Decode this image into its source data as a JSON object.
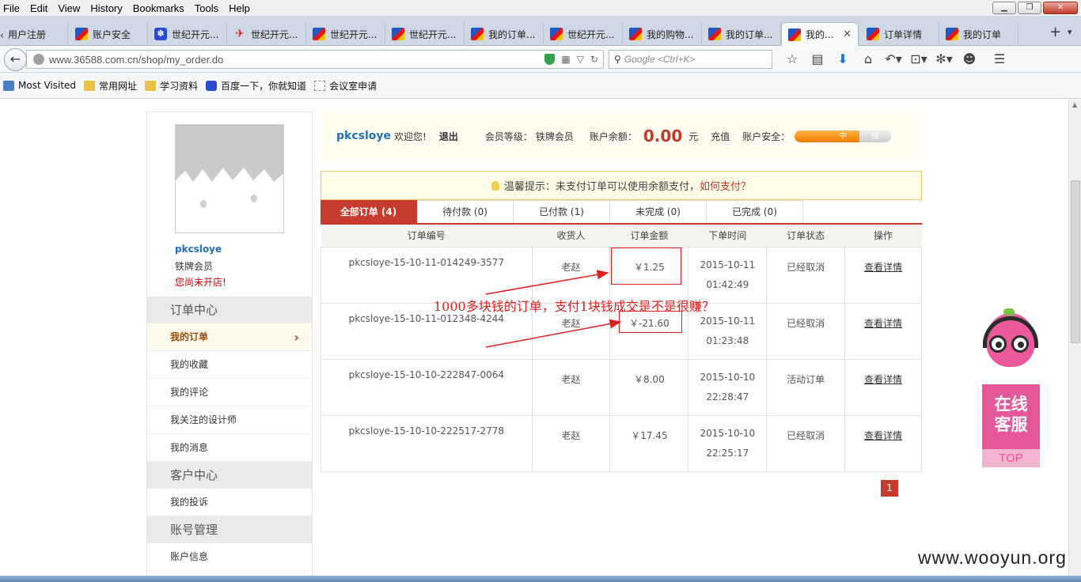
{
  "browser": {
    "menu": [
      "File",
      "Edit",
      "View",
      "History",
      "Bookmarks",
      "Tools",
      "Help"
    ],
    "tabs": [
      {
        "label": "用户注册",
        "icon": "none"
      },
      {
        "label": "账户安全",
        "icon": "brand"
      },
      {
        "label": "世纪开元...",
        "icon": "paw"
      },
      {
        "label": "世纪开元...",
        "icon": "bird"
      },
      {
        "label": "世纪开元...",
        "icon": "brand"
      },
      {
        "label": "世纪开元...",
        "icon": "brand"
      },
      {
        "label": "我的订单...",
        "icon": "brand"
      },
      {
        "label": "世纪开元...",
        "icon": "brand"
      },
      {
        "label": "我的购物...",
        "icon": "brand"
      },
      {
        "label": "我的订单...",
        "icon": "brand"
      },
      {
        "label": "我的...",
        "icon": "brand",
        "active": true
      },
      {
        "label": "订单详情",
        "icon": "brand"
      },
      {
        "label": "我的订单",
        "icon": "brand"
      }
    ],
    "url": "www.36588.com.cn/shop/my_order.do",
    "search_placeholder": "Google <Ctrl+K>",
    "bookmarks": [
      "Most Visited",
      "常用网址",
      "学习资料",
      "百度一下，你就知道",
      "会议室申请"
    ]
  },
  "sidebar": {
    "username": "pkcsloye",
    "level": "铁牌会员",
    "shop_status": "您尚未开店!",
    "sections": [
      {
        "title": "订单中心",
        "items": [
          {
            "label": "我的订单",
            "active": true
          },
          {
            "label": "我的收藏"
          },
          {
            "label": "我的评论"
          },
          {
            "label": "我关注的设计师"
          },
          {
            "label": "我的消息"
          }
        ]
      },
      {
        "title": "客户中心",
        "items": [
          {
            "label": "我的投诉"
          }
        ]
      },
      {
        "title": "账号管理",
        "items": [
          {
            "label": "账户信息"
          }
        ]
      }
    ]
  },
  "infobar": {
    "username": "pkcsloye",
    "welcome": "欢迎您!",
    "logout": "退出",
    "level_label": "会员等级：",
    "level": "铁牌会员",
    "balance_label": "账户余额：",
    "balance": "0.00",
    "currency_unit": "元",
    "recharge": "充值",
    "security_label": "账户安全：",
    "security_levels": [
      "",
      "中",
      "强"
    ],
    "security_active": "中"
  },
  "tip": {
    "text": "温馨提示：未支付订单可以使用余额支付，",
    "link": "如何支付？"
  },
  "order_tabs": [
    "全部订单 (4)",
    "待付款 (0)",
    "已付款 (1)",
    "未完成 (0)",
    "已完成 (0)"
  ],
  "table": {
    "headers": [
      "订单编号",
      "收货人",
      "订单金额",
      "下单时间",
      "订单状态",
      "操作"
    ],
    "rows": [
      {
        "id": "pkcsloye-15-10-11-014249-3577",
        "receiver": "老赵",
        "amount": "￥1.25",
        "date": "2015-10-11",
        "time": "01:42:49",
        "status": "已经取消",
        "action": "查看详情"
      },
      {
        "id": "pkcsloye-15-10-11-012348-4244",
        "receiver": "老赵",
        "amount": "￥-21.60",
        "date": "2015-10-11",
        "time": "01:23:48",
        "status": "已经取消",
        "action": "查看详情"
      },
      {
        "id": "pkcsloye-15-10-10-222847-0064",
        "receiver": "老赵",
        "amount": "￥8.00",
        "date": "2015-10-10",
        "time": "22:28:47",
        "status": "活动订单",
        "action": "查看详情"
      },
      {
        "id": "pkcsloye-15-10-10-222517-2778",
        "receiver": "老赵",
        "amount": "￥17.45",
        "date": "2015-10-10",
        "time": "22:25:17",
        "status": "已经取消",
        "action": "查看详情"
      }
    ]
  },
  "annotation": "1000多块钱的订单，支付1块钱成交是不是很赚？",
  "pager": {
    "current": "1"
  },
  "cs_widget": {
    "line1": "在线",
    "line2": "客服",
    "top": "TOP"
  },
  "watermark": "www.wooyun.org",
  "colors": {
    "accent": "#c73a2e",
    "link": "#2470b8",
    "annotation": "#e02020"
  }
}
